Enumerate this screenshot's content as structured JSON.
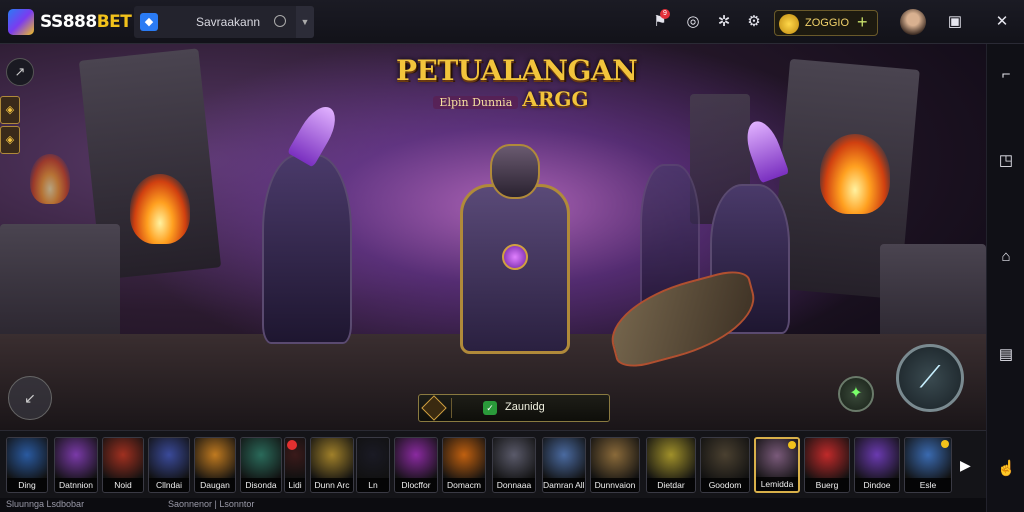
{
  "app": {
    "logo": "SS888BET",
    "logo_prefix": "SS888",
    "logo_accent": "BET",
    "tab_title": "Savraakann",
    "coins": "ZOGGIO",
    "coin_plus": "+",
    "notification_count": "9"
  },
  "game": {
    "title_line1": "PETUALANGAN",
    "title_subtitle": "Elpin Dunnia",
    "title_line2": "ARGG",
    "play_label": "Zaunidg"
  },
  "heroes": [
    {
      "name": "Ding",
      "color": "#2a5aa0"
    },
    {
      "name": "Datnnion",
      "color": "#7a3aa8"
    },
    {
      "name": "Noid",
      "color": "#a03020"
    },
    {
      "name": "Cllndai",
      "color": "#3a4a9a"
    },
    {
      "name": "Daugan",
      "color": "#c07a20"
    },
    {
      "name": "Disonda",
      "color": "#2a6a5a"
    },
    {
      "name": "Lidi",
      "color": "#3a1a1a"
    },
    {
      "name": "Dunn Arc",
      "color": "#a0802a"
    },
    {
      "name": "Ln",
      "color": "#1a1a24"
    },
    {
      "name": "Dlocffor",
      "color": "#8a2aa0"
    },
    {
      "name": "Domacm",
      "color": "#c06010"
    },
    {
      "name": "Donnaaa",
      "color": "#5a5a6a"
    },
    {
      "name": "Damran Alla",
      "color": "#4a6aa0"
    },
    {
      "name": "Dunnvaion",
      "color": "#8a6a3a"
    },
    {
      "name": "Dietdar",
      "color": "#a0902a"
    },
    {
      "name": "Goodom",
      "color": "#4a4030"
    },
    {
      "name": "Lemidda",
      "color": "#7a5a7a"
    },
    {
      "name": "Buerg",
      "color": "#c02a2a"
    },
    {
      "name": "Dindoe",
      "color": "#6a3ab0"
    },
    {
      "name": "Esle",
      "color": "#3a6ab0"
    }
  ],
  "status": {
    "left": "Sluunnga Lsdbobar",
    "mid": "Saonnenor | Lsonntor"
  },
  "icons": {
    "tab": "app-tab-icon",
    "coin": "coin-icon",
    "settings": "gear-icon",
    "close": "close-icon",
    "maximize": "maximize-icon"
  },
  "colors": {
    "accent_gold": "#f2c21b",
    "brand_blue": "#2a7bf4",
    "background": "#0b0b12"
  }
}
